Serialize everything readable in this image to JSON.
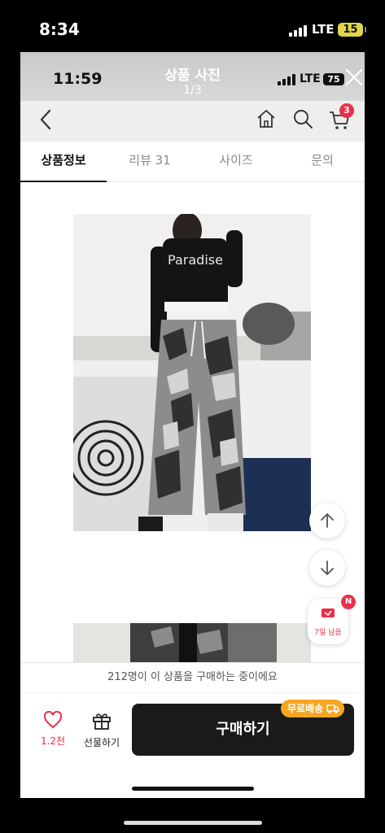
{
  "outer_status": {
    "time": "8:34",
    "network": "LTE",
    "battery": "15"
  },
  "inner_status": {
    "time": "11:59",
    "network": "LTE",
    "battery": "75"
  },
  "photo_viewer": {
    "title": "상품 사진",
    "counter": "1/3"
  },
  "nav": {
    "cart_count": "3",
    "icons": [
      "back-icon",
      "home-icon",
      "search-icon",
      "cart-icon"
    ]
  },
  "tabs": [
    {
      "label": "상품정보",
      "active": true
    },
    {
      "label": "리뷰 31",
      "active": false
    },
    {
      "label": "사이즈",
      "active": false
    },
    {
      "label": "문의",
      "active": false
    }
  ],
  "product_text": {
    "shirt_print": "Paradise"
  },
  "floating": {
    "coupon_label": "7일 남음",
    "coupon_badge": "N"
  },
  "buyer_notice": "212명이 이 상품을 구매하는 중이에요",
  "bottom": {
    "like_count": "1.2천",
    "gift_label": "선물하기",
    "buy_label": "구매하기",
    "free_shipping": "무료배송"
  },
  "colors": {
    "accent_red": "#e9304a",
    "buy_button": "#1a1a1a",
    "free_shipping": "#f5a623"
  }
}
